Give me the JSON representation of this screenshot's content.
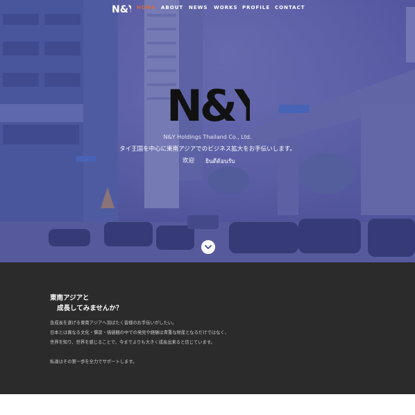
{
  "nav": {
    "logo_text": "N&Y",
    "items": [
      {
        "label": "HOME",
        "active": true
      },
      {
        "label": "ABOUT",
        "active": false
      },
      {
        "label": "NEWS",
        "active": false
      },
      {
        "label": "WORKS",
        "active": false
      },
      {
        "label": "PROFILE",
        "active": false
      },
      {
        "label": "CONTACT",
        "active": false
      }
    ]
  },
  "hero": {
    "logo_text": "N&Y",
    "company": "N&Y Holdings Thailand Co., Ltd.",
    "tagline": "タイ王国を中心に東南アジアでのビジネス拡大をお手伝いします。",
    "welcome_ja": "欢迎",
    "welcome_th": "ยินดีต้อนรับ",
    "scroll_icon": "chevron-down-icon"
  },
  "intro": {
    "heading_line1": "東南アジアと",
    "heading_line2": "成長してみませんか？",
    "body": [
      "急成長を遂げる東南アジアへ羽ばたく皆様のお手伝いがしたい。",
      "日本とは異なる文化・慣習・価値観の中での発見や経験は貴重な財産となるだけではなく、",
      "世界を知り、世界を感じることで、今までよりも大きく成長出来ると信じています。",
      "私達はその第一歩を全力でサポートします。"
    ]
  },
  "colors": {
    "hero_tint": "#5c5fa6",
    "nav_active": "#d86a3a",
    "intro_bg": "#2b2b2b"
  }
}
